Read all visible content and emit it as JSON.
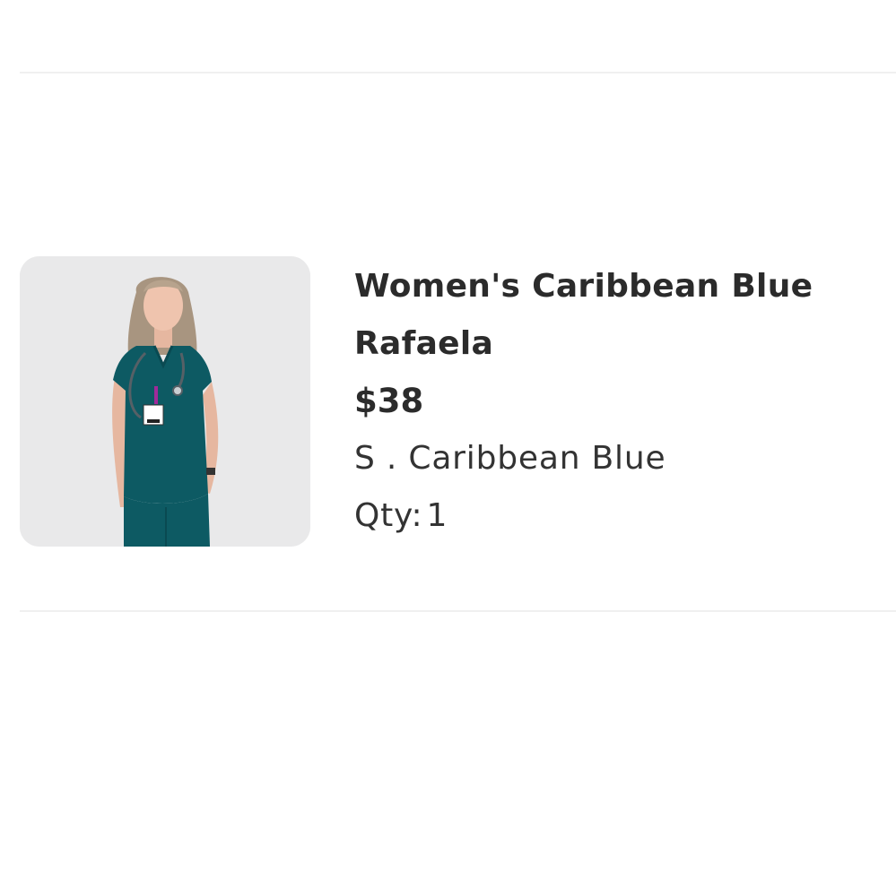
{
  "cart_item": {
    "image_alt": "Woman in Caribbean Blue scrub top with stethoscope",
    "product_title": "Women's Caribbean Blue Rafaela",
    "price": "$38",
    "variant": "S . Caribbean Blue",
    "qty_label": "Qty:",
    "qty_value": "1"
  },
  "colors": {
    "scrub_teal": "#0d5a63",
    "image_background": "#e9e9ea",
    "divider": "#f0f0f0",
    "text": "#2b2b2b"
  }
}
